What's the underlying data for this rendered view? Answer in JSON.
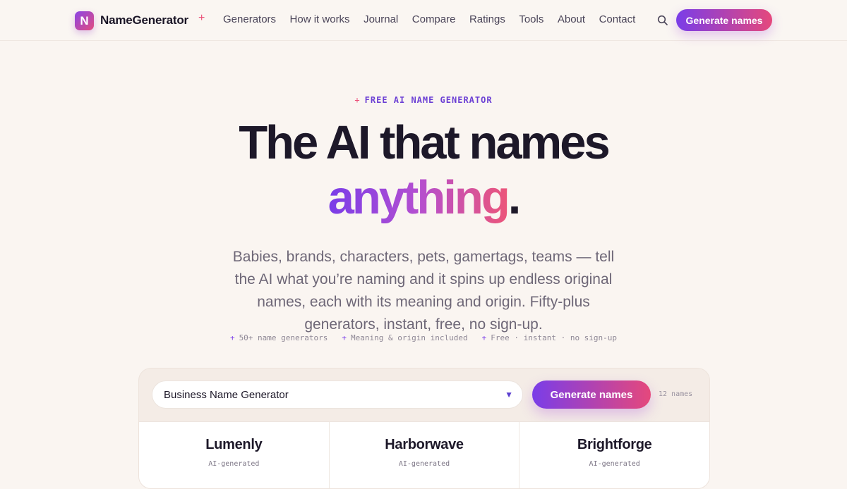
{
  "nav": {
    "logo_letter": "N",
    "brand": "NameGenerator",
    "brand_spark": "+",
    "links": [
      "Generators",
      "How it works",
      "Journal",
      "Compare",
      "Ratings",
      "Tools",
      "About",
      "Contact"
    ],
    "cta": "Generate names"
  },
  "hero": {
    "eyebrow_spark": "+",
    "eyebrow": "FREE AI NAME GENERATOR",
    "title_line1": "The AI that names",
    "title_accent": "anything",
    "title_period": ".",
    "lead": "Babies, brands, characters, pets, gamertags, teams — tell the AI what you’re naming and it spins up endless original names, each with its meaning and origin. Fifty-plus generators, instant, free, no sign-up.",
    "features": [
      {
        "spark": "+",
        "text": "50+ name generators"
      },
      {
        "spark": "+",
        "text": "Meaning & origin included"
      },
      {
        "spark": "+",
        "text": "Free · instant · no sign-up"
      }
    ]
  },
  "generator": {
    "selected": "Business Name Generator",
    "caret": "▼",
    "button": "Generate names",
    "count": "12 names",
    "results": [
      {
        "name": "Lumenly",
        "tag": "AI-generated"
      },
      {
        "name": "Harborwave",
        "tag": "AI-generated"
      },
      {
        "name": "Brightforge",
        "tag": "AI-generated"
      }
    ]
  },
  "colors": {
    "accent_purple": "#7a3de8",
    "accent_pink": "#e5487c",
    "background": "#faf5f1"
  }
}
